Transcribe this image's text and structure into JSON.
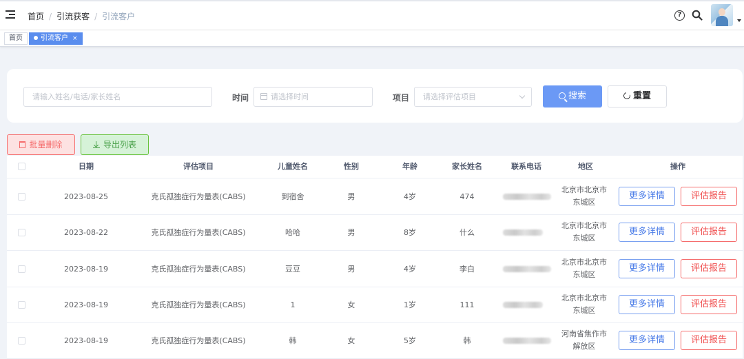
{
  "breadcrumb": [
    "首页",
    "引流获客",
    "引流客户"
  ],
  "tags": [
    {
      "label": "首页",
      "active": false
    },
    {
      "label": "引流客户",
      "active": true,
      "close": "×"
    }
  ],
  "filters": {
    "search_placeholder": "请输入姓名/电话/家长姓名",
    "time_label": "时间",
    "time_placeholder": "请选择时间",
    "project_label": "项目",
    "project_placeholder": "请选择评估项目",
    "search_button": "搜索",
    "reset_button": "重置"
  },
  "actions": {
    "batch_delete": "批量删除",
    "export_list": "导出列表"
  },
  "table": {
    "headers": [
      "日期",
      "评估项目",
      "儿童姓名",
      "性别",
      "年龄",
      "家长姓名",
      "联系电话",
      "地区",
      "操作"
    ],
    "more_label": "更多详情",
    "report_label": "评估报告",
    "rows": [
      {
        "date": "2023-08-25",
        "project": "克氏孤独症行为量表(CABS)",
        "child": "到宿舍",
        "gender": "男",
        "age": "4岁",
        "parent": "474",
        "region1": "北京市北京市",
        "region2": "东城区"
      },
      {
        "date": "2023-08-22",
        "project": "克氏孤独症行为量表(CABS)",
        "child": "哈哈",
        "gender": "男",
        "age": "8岁",
        "parent": "什么",
        "region1": "北京市北京市",
        "region2": "东城区"
      },
      {
        "date": "2023-08-19",
        "project": "克氏孤独症行为量表(CABS)",
        "child": "豆豆",
        "gender": "男",
        "age": "4岁",
        "parent": "李白",
        "region1": "北京市北京市",
        "region2": "东城区"
      },
      {
        "date": "2023-08-19",
        "project": "克氏孤独症行为量表(CABS)",
        "child": "1",
        "gender": "女",
        "age": "1岁",
        "parent": "111",
        "region1": "北京市北京市",
        "region2": "东城区"
      },
      {
        "date": "2023-08-19",
        "project": "克氏孤独症行为量表(CABS)",
        "child": "韩",
        "gender": "女",
        "age": "5岁",
        "parent": "韩",
        "region1": "河南省焦作市",
        "region2": "解放区"
      }
    ]
  },
  "colors": {
    "primary": "#6b99f5",
    "danger": "#f56c6c",
    "success": "#67c23a"
  }
}
